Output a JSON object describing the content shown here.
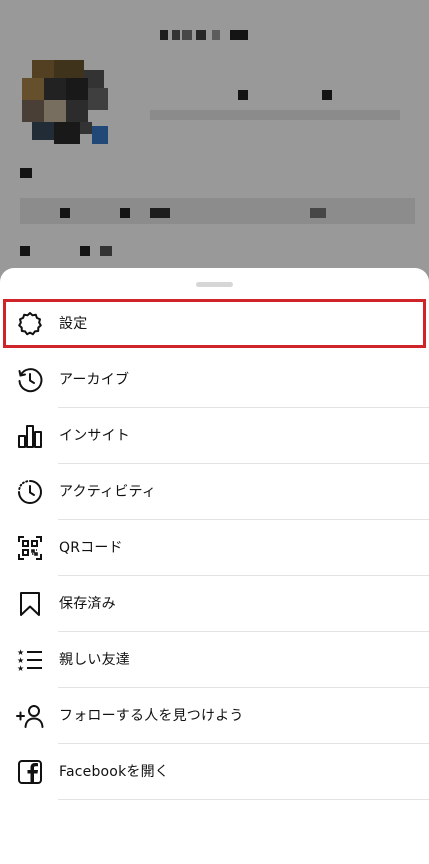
{
  "colors": {
    "overlay": "rgba(0,0,0,0.40)",
    "highlight_border": "#d0242b",
    "separator": "#e3e3e3",
    "text": "#111111"
  },
  "menu": {
    "items": [
      {
        "label": "設定",
        "icon": "gear-icon",
        "highlighted": true
      },
      {
        "label": "アーカイブ",
        "icon": "archive-history-icon"
      },
      {
        "label": "インサイト",
        "icon": "insights-bar-chart-icon"
      },
      {
        "label": "アクティビティ",
        "icon": "activity-clock-icon"
      },
      {
        "label": "QRコード",
        "icon": "qr-code-icon"
      },
      {
        "label": "保存済み",
        "icon": "bookmark-icon"
      },
      {
        "label": "親しい友達",
        "icon": "close-friends-list-icon"
      },
      {
        "label": "フォローする人を見つけよう",
        "icon": "add-person-icon"
      },
      {
        "label": "Facebookを開く",
        "icon": "facebook-icon"
      }
    ]
  }
}
